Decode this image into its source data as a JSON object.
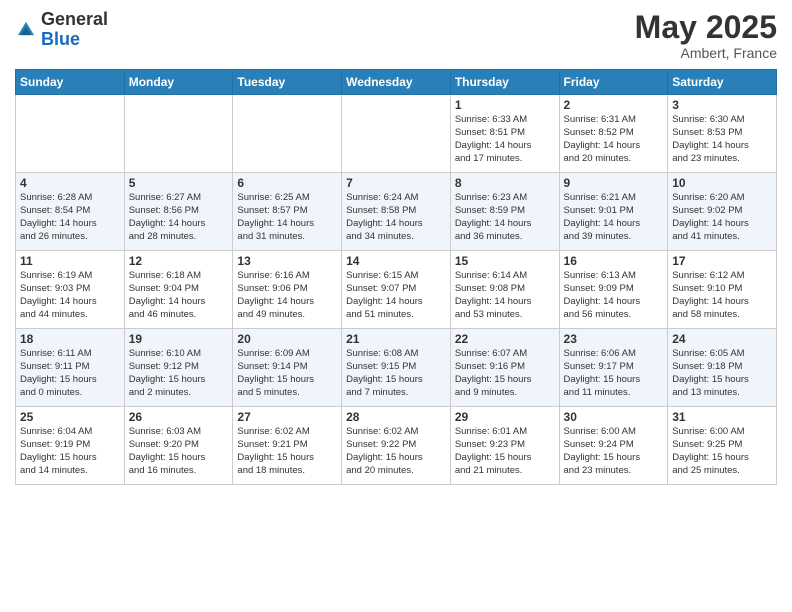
{
  "header": {
    "logo_general": "General",
    "logo_blue": "Blue",
    "month_title": "May 2025",
    "location": "Ambert, France"
  },
  "days_of_week": [
    "Sunday",
    "Monday",
    "Tuesday",
    "Wednesday",
    "Thursday",
    "Friday",
    "Saturday"
  ],
  "weeks": [
    [
      {
        "day": "",
        "info": ""
      },
      {
        "day": "",
        "info": ""
      },
      {
        "day": "",
        "info": ""
      },
      {
        "day": "",
        "info": ""
      },
      {
        "day": "1",
        "info": "Sunrise: 6:33 AM\nSunset: 8:51 PM\nDaylight: 14 hours\nand 17 minutes."
      },
      {
        "day": "2",
        "info": "Sunrise: 6:31 AM\nSunset: 8:52 PM\nDaylight: 14 hours\nand 20 minutes."
      },
      {
        "day": "3",
        "info": "Sunrise: 6:30 AM\nSunset: 8:53 PM\nDaylight: 14 hours\nand 23 minutes."
      }
    ],
    [
      {
        "day": "4",
        "info": "Sunrise: 6:28 AM\nSunset: 8:54 PM\nDaylight: 14 hours\nand 26 minutes."
      },
      {
        "day": "5",
        "info": "Sunrise: 6:27 AM\nSunset: 8:56 PM\nDaylight: 14 hours\nand 28 minutes."
      },
      {
        "day": "6",
        "info": "Sunrise: 6:25 AM\nSunset: 8:57 PM\nDaylight: 14 hours\nand 31 minutes."
      },
      {
        "day": "7",
        "info": "Sunrise: 6:24 AM\nSunset: 8:58 PM\nDaylight: 14 hours\nand 34 minutes."
      },
      {
        "day": "8",
        "info": "Sunrise: 6:23 AM\nSunset: 8:59 PM\nDaylight: 14 hours\nand 36 minutes."
      },
      {
        "day": "9",
        "info": "Sunrise: 6:21 AM\nSunset: 9:01 PM\nDaylight: 14 hours\nand 39 minutes."
      },
      {
        "day": "10",
        "info": "Sunrise: 6:20 AM\nSunset: 9:02 PM\nDaylight: 14 hours\nand 41 minutes."
      }
    ],
    [
      {
        "day": "11",
        "info": "Sunrise: 6:19 AM\nSunset: 9:03 PM\nDaylight: 14 hours\nand 44 minutes."
      },
      {
        "day": "12",
        "info": "Sunrise: 6:18 AM\nSunset: 9:04 PM\nDaylight: 14 hours\nand 46 minutes."
      },
      {
        "day": "13",
        "info": "Sunrise: 6:16 AM\nSunset: 9:06 PM\nDaylight: 14 hours\nand 49 minutes."
      },
      {
        "day": "14",
        "info": "Sunrise: 6:15 AM\nSunset: 9:07 PM\nDaylight: 14 hours\nand 51 minutes."
      },
      {
        "day": "15",
        "info": "Sunrise: 6:14 AM\nSunset: 9:08 PM\nDaylight: 14 hours\nand 53 minutes."
      },
      {
        "day": "16",
        "info": "Sunrise: 6:13 AM\nSunset: 9:09 PM\nDaylight: 14 hours\nand 56 minutes."
      },
      {
        "day": "17",
        "info": "Sunrise: 6:12 AM\nSunset: 9:10 PM\nDaylight: 14 hours\nand 58 minutes."
      }
    ],
    [
      {
        "day": "18",
        "info": "Sunrise: 6:11 AM\nSunset: 9:11 PM\nDaylight: 15 hours\nand 0 minutes."
      },
      {
        "day": "19",
        "info": "Sunrise: 6:10 AM\nSunset: 9:12 PM\nDaylight: 15 hours\nand 2 minutes."
      },
      {
        "day": "20",
        "info": "Sunrise: 6:09 AM\nSunset: 9:14 PM\nDaylight: 15 hours\nand 5 minutes."
      },
      {
        "day": "21",
        "info": "Sunrise: 6:08 AM\nSunset: 9:15 PM\nDaylight: 15 hours\nand 7 minutes."
      },
      {
        "day": "22",
        "info": "Sunrise: 6:07 AM\nSunset: 9:16 PM\nDaylight: 15 hours\nand 9 minutes."
      },
      {
        "day": "23",
        "info": "Sunrise: 6:06 AM\nSunset: 9:17 PM\nDaylight: 15 hours\nand 11 minutes."
      },
      {
        "day": "24",
        "info": "Sunrise: 6:05 AM\nSunset: 9:18 PM\nDaylight: 15 hours\nand 13 minutes."
      }
    ],
    [
      {
        "day": "25",
        "info": "Sunrise: 6:04 AM\nSunset: 9:19 PM\nDaylight: 15 hours\nand 14 minutes."
      },
      {
        "day": "26",
        "info": "Sunrise: 6:03 AM\nSunset: 9:20 PM\nDaylight: 15 hours\nand 16 minutes."
      },
      {
        "day": "27",
        "info": "Sunrise: 6:02 AM\nSunset: 9:21 PM\nDaylight: 15 hours\nand 18 minutes."
      },
      {
        "day": "28",
        "info": "Sunrise: 6:02 AM\nSunset: 9:22 PM\nDaylight: 15 hours\nand 20 minutes."
      },
      {
        "day": "29",
        "info": "Sunrise: 6:01 AM\nSunset: 9:23 PM\nDaylight: 15 hours\nand 21 minutes."
      },
      {
        "day": "30",
        "info": "Sunrise: 6:00 AM\nSunset: 9:24 PM\nDaylight: 15 hours\nand 23 minutes."
      },
      {
        "day": "31",
        "info": "Sunrise: 6:00 AM\nSunset: 9:25 PM\nDaylight: 15 hours\nand 25 minutes."
      }
    ]
  ]
}
